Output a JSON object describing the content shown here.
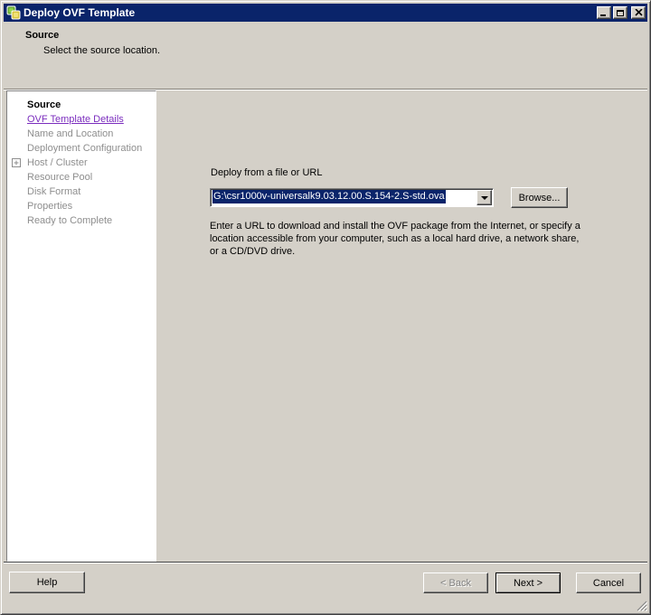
{
  "window": {
    "title": "Deploy OVF Template",
    "controls": {
      "minimize": "minimize-icon",
      "maximize": "maximize-icon",
      "close": "close-icon"
    }
  },
  "colors": {
    "titlebar": "#0a246a",
    "dialog_bg": "#d4d0c8",
    "sidebar_bg": "#ffffff",
    "link": "#7b2dbe",
    "selection_bg": "#0a246a",
    "selection_text": "#ffffff",
    "disabled_text": "#8e8e8e"
  },
  "header": {
    "title": "Source",
    "subtitle": "Select the source location."
  },
  "sidebar": {
    "items": [
      {
        "label": "Source",
        "state": "current"
      },
      {
        "label": "OVF Template Details",
        "state": "link"
      },
      {
        "label": "Name and Location",
        "state": "upcoming"
      },
      {
        "label": "Deployment Configuration",
        "state": "upcoming"
      },
      {
        "label": "Host / Cluster",
        "state": "upcoming",
        "expandable": true
      },
      {
        "label": "Resource Pool",
        "state": "upcoming"
      },
      {
        "label": "Disk Format",
        "state": "upcoming"
      },
      {
        "label": "Properties",
        "state": "upcoming"
      },
      {
        "label": "Ready to Complete",
        "state": "upcoming"
      }
    ]
  },
  "content": {
    "field_label": "Deploy from a file or URL",
    "file_input": {
      "value": "G:\\csr1000v-universalk9.03.12.00.S.154-2.S-std.ova",
      "selected": true
    },
    "browse_button": "Browse...",
    "description": "Enter a URL to download and install the OVF package from the Internet, or specify a location accessible from your computer, such as a local hard drive, a network share, or a CD/DVD drive."
  },
  "footer": {
    "help": "Help",
    "back": "< Back",
    "next": "Next >",
    "cancel": "Cancel"
  }
}
